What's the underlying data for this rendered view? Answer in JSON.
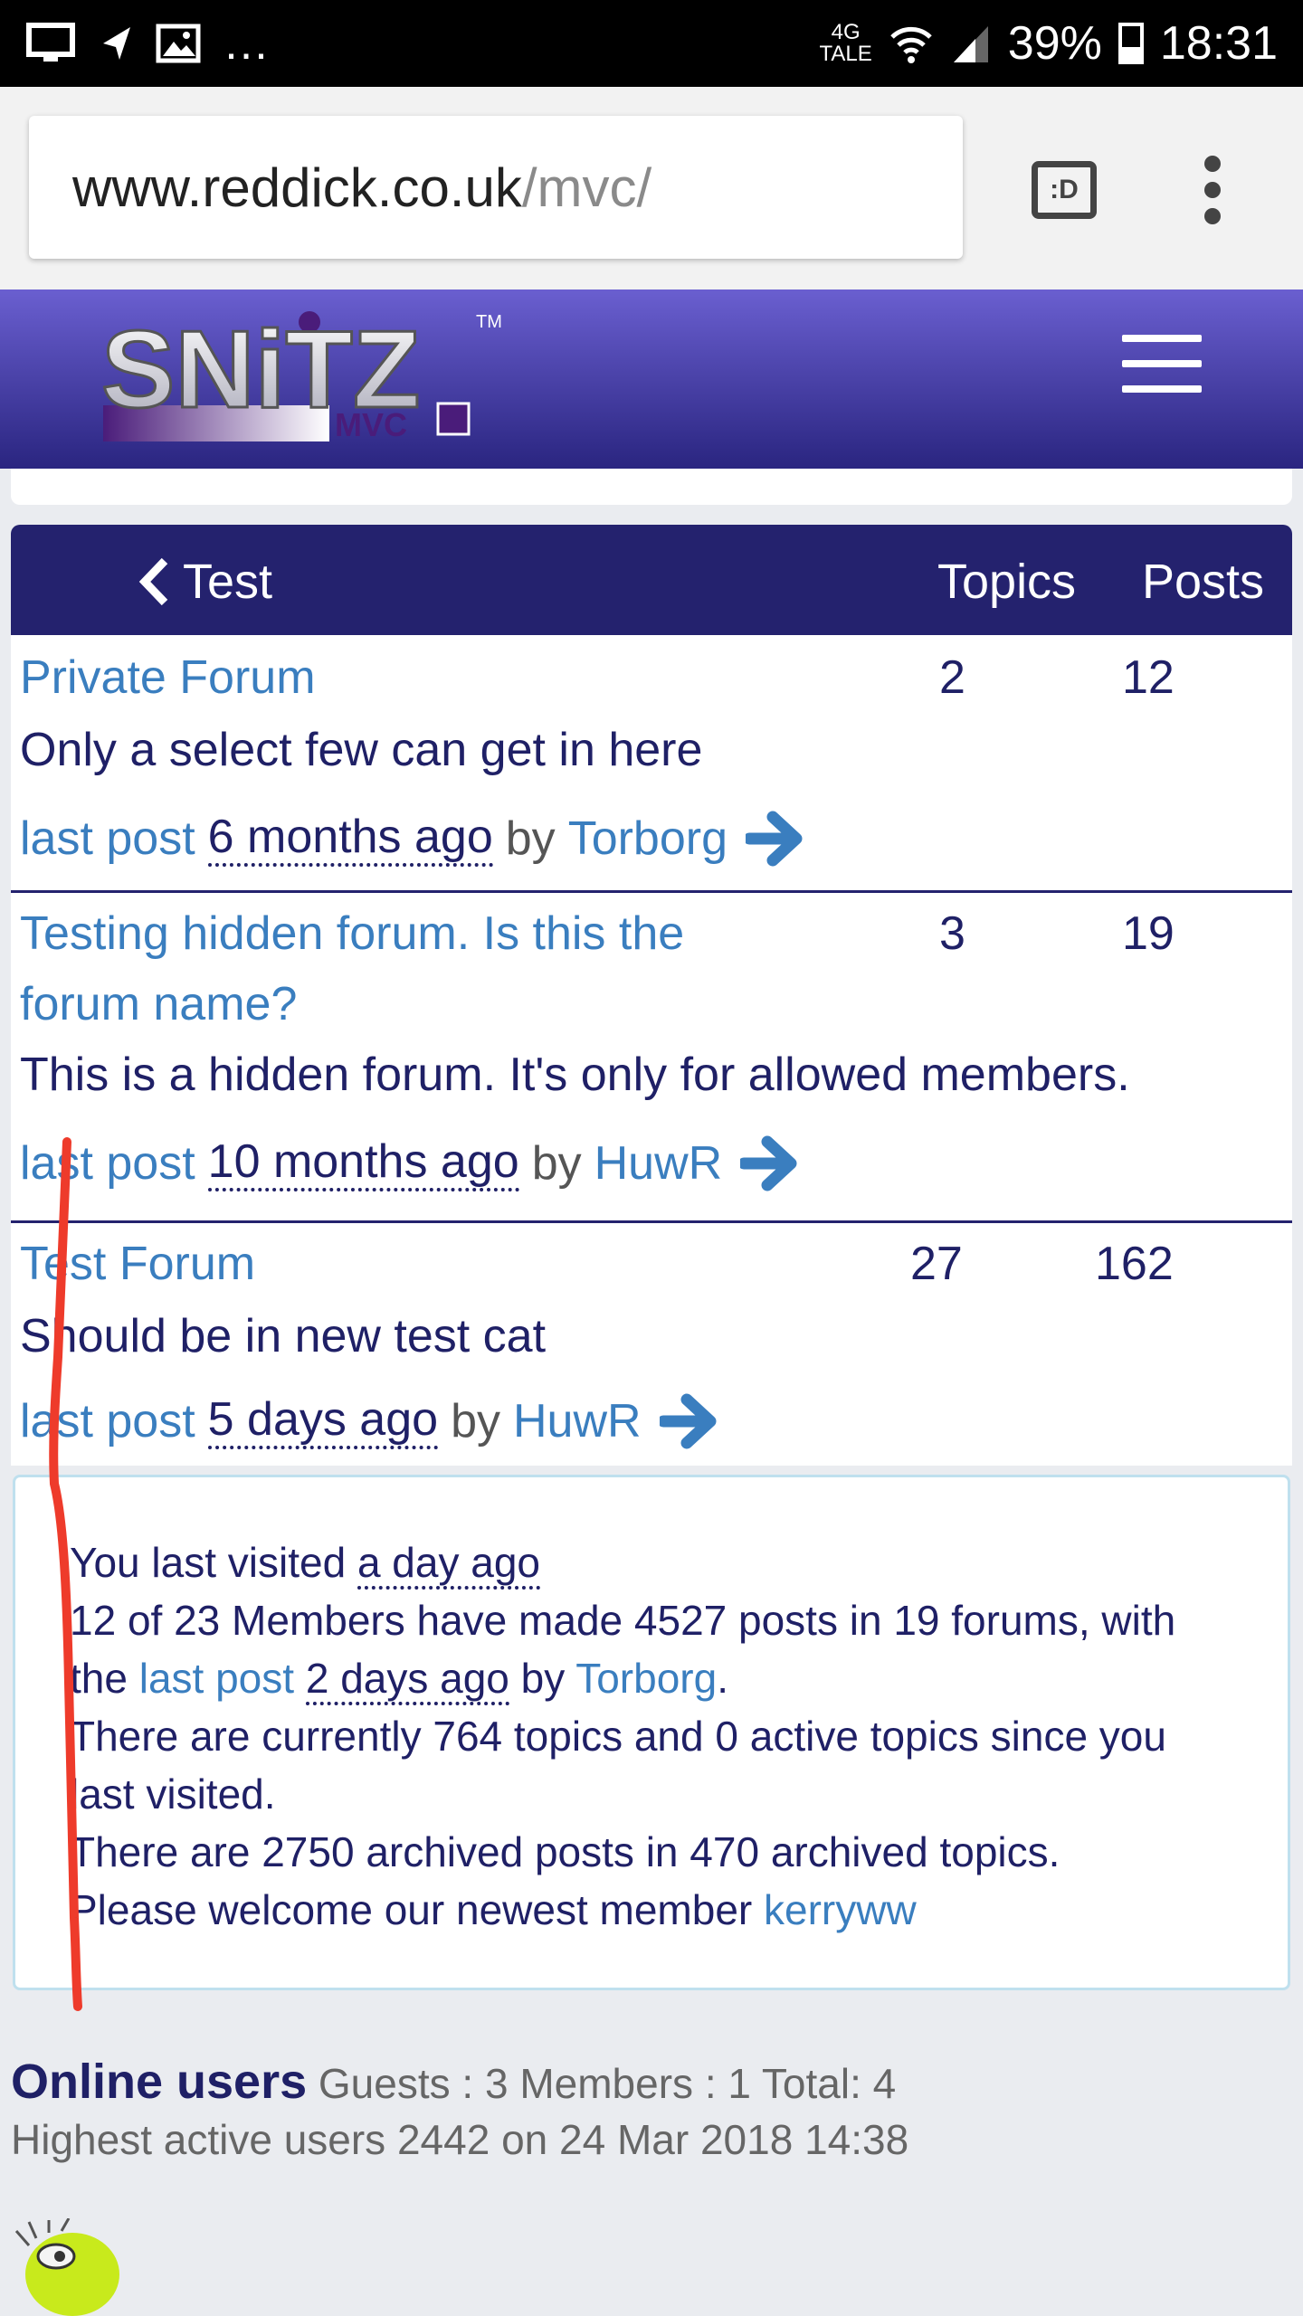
{
  "statusbar": {
    "time": "18:31",
    "battery": "39%",
    "network_top": "4G",
    "network_bottom": "TALE",
    "battery_level": 0.39
  },
  "browser": {
    "url_host": "www.reddick.co.uk",
    "url_path": "/mvc/",
    "tab_icon_label": ":D"
  },
  "header": {
    "logo_text": "SNiTZ",
    "logo_sub": "MVC",
    "logo_tm": "TM"
  },
  "forum_table": {
    "category": "Test",
    "col_topics": "Topics",
    "col_posts": "Posts",
    "rows": [
      {
        "name": "Private Forum",
        "description": "Only a select few can get in here",
        "topics": "2",
        "posts": "12",
        "last_post_label": "last post",
        "last_post_ago": "6 months ago",
        "by": "by",
        "user": "Torborg"
      },
      {
        "name": "Testing hidden forum. Is this the forum name?",
        "description": "This is a hidden forum. It's only for allowed members.",
        "topics": "3",
        "posts": "19",
        "last_post_label": "last post",
        "last_post_ago": "10 months ago",
        "by": "by",
        "user": "HuwR"
      },
      {
        "name": "Test Forum",
        "description": "Should be in new test cat",
        "topics": "27",
        "posts": "162",
        "last_post_label": "last post",
        "last_post_ago": "5 days ago",
        "by": "by",
        "user": "HuwR"
      }
    ]
  },
  "stats": {
    "visited_prefix": "You last visited",
    "visited_ago": "a day ago",
    "members_line": "12 of 23 Members have made 4527 posts in 19 forums, with",
    "the": "the",
    "last_post_label": "last post",
    "last_post_ago": "2 days ago",
    "by": "by",
    "last_post_user": "Torborg",
    "period": ".",
    "topics_line1": "There are currently 764 topics and 0 active topics since you",
    "topics_line2": "last visited.",
    "archive_line": "There are 2750 archived posts in 470 archived topics.",
    "welcome_prefix": "Please welcome our newest member",
    "newest_member": "kerryww"
  },
  "online": {
    "title": "Online users",
    "counts": "Guests : 3 Members : 1 Total: 4",
    "highest": "Highest active users 2442 on 24 Mar 2018 14:38"
  },
  "colors": {
    "header_top": "#6a5fd0",
    "header_bottom": "#2a2580",
    "table_head": "#24226e",
    "link": "#3a7ebf",
    "text": "#1f2066",
    "annotation": "#ee3b2b"
  }
}
